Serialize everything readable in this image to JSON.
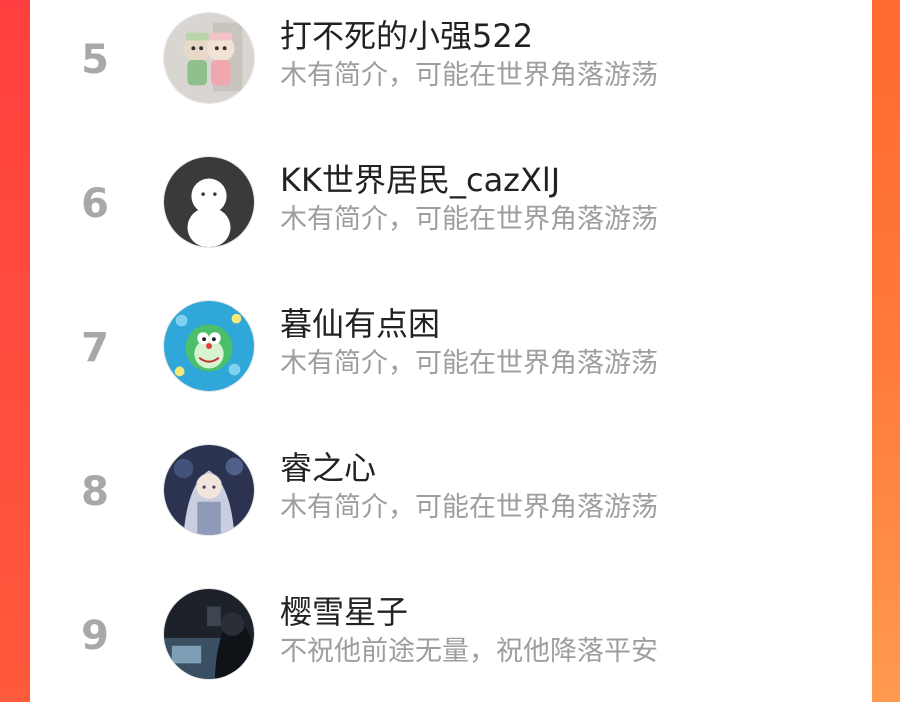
{
  "list": {
    "items": [
      {
        "rank": "5",
        "name": "打不死的小强522",
        "bio": "木有简介，可能在世界角落游荡",
        "avatar": "figurines-avatar"
      },
      {
        "rank": "6",
        "name": "KK世界居民_cazXlJ",
        "bio": "木有简介，可能在世界角落游荡",
        "avatar": "default-avatar"
      },
      {
        "rank": "7",
        "name": "暮仙有点困",
        "bio": "木有简介，可能在世界角落游荡",
        "avatar": "doraemon-avatar"
      },
      {
        "rank": "8",
        "name": "睿之心",
        "bio": "木有简介，可能在世界角落游荡",
        "avatar": "anime-girl-avatar"
      },
      {
        "rank": "9",
        "name": "樱雪星子",
        "bio": "不祝他前途无量，祝他降落平安",
        "avatar": "dark-photo-avatar"
      }
    ]
  },
  "colors": {
    "background_left": "#ff3f3f",
    "background_right": "#ff7a3a",
    "panel": "#ffffff",
    "rank": "#a8a8a8",
    "name": "#222222",
    "bio": "#9e9e9e"
  }
}
